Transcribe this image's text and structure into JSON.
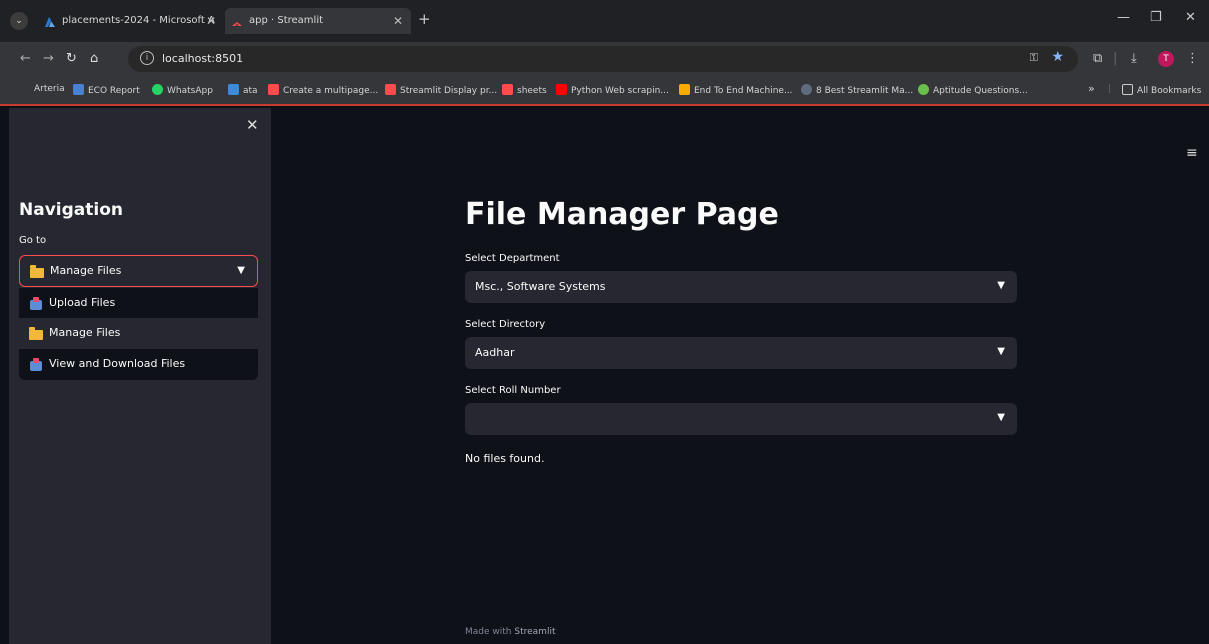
{
  "browser": {
    "tabs": [
      {
        "title": "placements-2024 - Microsoft A",
        "icon": "azure-icon"
      },
      {
        "title": "app · Streamlit",
        "icon": "streamlit-icon",
        "active": true
      }
    ],
    "url": "localhost:8501",
    "profile_initial": "T",
    "bookmarks": [
      {
        "label": "Arteria",
        "icon": ""
      },
      {
        "label": "ECO Report",
        "icon": "report-icon"
      },
      {
        "label": "WhatsApp",
        "icon": "whatsapp-icon"
      },
      {
        "label": "ata",
        "icon": "ata-icon"
      },
      {
        "label": "Create a multipage...",
        "icon": "streamlit-icon"
      },
      {
        "label": "Streamlit Display pr...",
        "icon": "streamlit-icon"
      },
      {
        "label": "sheets",
        "icon": "streamlit-icon"
      },
      {
        "label": "Python Web scrapin...",
        "icon": "youtube-icon"
      },
      {
        "label": "End To End Machine...",
        "icon": "colab-icon"
      },
      {
        "label": "8 Best Streamlit Ma...",
        "icon": "web-icon"
      },
      {
        "label": "Aptitude Questions...",
        "icon": "tree-icon"
      }
    ],
    "overflow_label": "»",
    "all_bookmarks": "All Bookmarks"
  },
  "sidebar": {
    "title": "Navigation",
    "goto_label": "Go to",
    "selected": "Manage Files",
    "options": [
      "Upload Files",
      "Manage Files",
      "View and Download Files"
    ],
    "highlighted_index": 1
  },
  "main": {
    "title": "File Manager Page",
    "department": {
      "label": "Select Department",
      "value": "Msc., Software Systems"
    },
    "directory": {
      "label": "Select Directory",
      "value": "Aadhar"
    },
    "roll": {
      "label": "Select Roll Number",
      "value": ""
    },
    "status": "No files found.",
    "footer_prefix": "Made with",
    "footer_brand": "Streamlit"
  },
  "colors": {
    "accent": "#ff4b4b",
    "background": "#0e1117",
    "sidebar": "#262730"
  }
}
